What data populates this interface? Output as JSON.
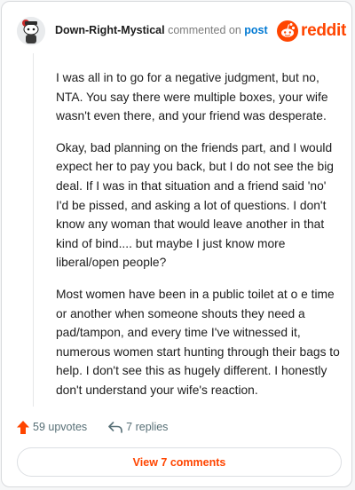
{
  "comment": {
    "author": "Down-Right-Mystical",
    "action_text": "commented on",
    "post_link": "post",
    "brand": "reddit",
    "paragraphs": [
      "I was all in to go for a negative judgment, but no, NTA. You say there were multiple boxes, your wife wasn't even there, and your friend was desperate.",
      "Okay, bad planning on the friends part, and I would expect her to pay you back, but I do not see the big deal. If I was in that situation and a friend said 'no' I'd be pissed, and asking a lot of questions. I don't know any woman that would leave another in that kind of bind.... but maybe I just know more liberal/open people?",
      "Most women have been in a public toilet at o e time or another when someone shouts they need a pad/tampon, and every time I've witnessed it, numerous women start hunting through their bags to help. I don't see this as hugely different. I honestly don't understand your wife's reaction."
    ],
    "upvotes": "59 upvotes",
    "replies": "7 replies",
    "view_button": "View 7 comments"
  },
  "colors": {
    "brand_orange": "#ff4500",
    "link_blue": "#0079d3",
    "meta_gray": "#576f76"
  },
  "icons": {
    "avatar": "snoo-avatar",
    "brand": "reddit-logo-icon",
    "upvote": "upvote-arrow-icon",
    "reply": "reply-arrow-icon"
  }
}
